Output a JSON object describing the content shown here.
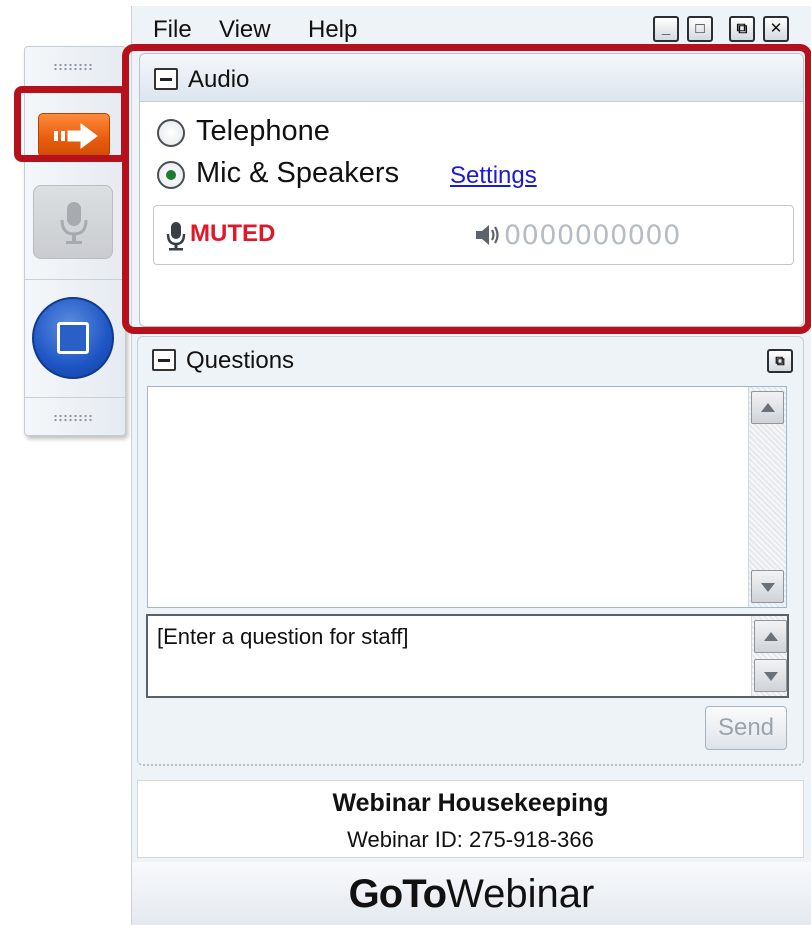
{
  "menu": {
    "file": "File",
    "view": "View",
    "help": "Help"
  },
  "window_controls": {
    "minimize": "_",
    "maximize": "□",
    "restore": "⧉",
    "close": "✕"
  },
  "audio": {
    "title": "Audio",
    "options": [
      {
        "label": "Telephone",
        "selected": false
      },
      {
        "label": "Mic & Speakers",
        "selected": true
      }
    ],
    "settings_link": "Settings",
    "status": "MUTED",
    "level_meter": "0000000000"
  },
  "questions": {
    "title": "Questions",
    "input_placeholder": "[Enter a question for staff]",
    "send_label": "Send"
  },
  "info": {
    "title": "Webinar Housekeeping",
    "webinar_id": "Webinar ID: 275-918-366"
  },
  "brand": {
    "bold": "GoTo",
    "regular": "Webinar"
  },
  "colors": {
    "accent_orange": "#e85c0c",
    "screen_blue": "#1e55c4",
    "muted_red": "#e0182a",
    "highlight_red": "#b5101c",
    "link_blue": "#1a1ad6"
  },
  "icons": [
    "grab-tab-arrow-icon",
    "microphone-icon",
    "screen-share-icon",
    "speaker-icon"
  ]
}
